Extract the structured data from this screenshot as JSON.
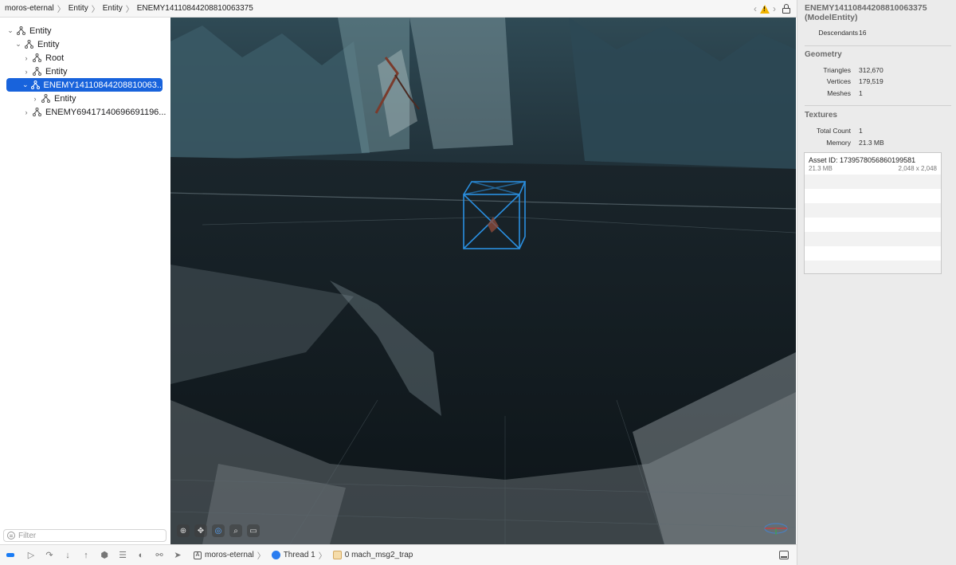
{
  "breadcrumb": [
    "moros-eternal",
    "Entity",
    "Entity",
    "ENEMY14110844208810063375"
  ],
  "outline": {
    "items": [
      {
        "label": "Entity",
        "expanded": true,
        "selected": false
      },
      {
        "label": "Entity",
        "expanded": true,
        "selected": false
      },
      {
        "label": "Root",
        "expanded": false,
        "selected": false
      },
      {
        "label": "Entity",
        "expanded": false,
        "selected": false
      },
      {
        "label": "ENEMY14110844208810063...",
        "expanded": true,
        "selected": true
      },
      {
        "label": "Entity",
        "expanded": false,
        "selected": false
      },
      {
        "label": "ENEMY69417140696691196...",
        "expanded": false,
        "selected": false
      }
    ],
    "filter_placeholder": "Filter"
  },
  "viewport": {
    "toolbar_icons": [
      "move-icon",
      "pan-icon",
      "orbit-icon",
      "zoom-icon",
      "camera-icon"
    ],
    "selection_color": "#2a8fe0"
  },
  "debugbar": {
    "app": "moros-eternal",
    "thread": "Thread 1",
    "frame": "0 mach_msg2_trap"
  },
  "inspector": {
    "title": "ENEMY14110844208810063375 (ModelEntity)",
    "descendants_label": "Descendants",
    "descendants_value": "16",
    "geometry": {
      "heading": "Geometry",
      "triangles_label": "Triangles",
      "triangles_value": "312,670",
      "vertices_label": "Vertices",
      "vertices_value": "179,519",
      "meshes_label": "Meshes",
      "meshes_value": "1"
    },
    "textures": {
      "heading": "Textures",
      "count_label": "Total Count",
      "count_value": "1",
      "memory_label": "Memory",
      "memory_value": "21.3 MB"
    },
    "asset": {
      "id": "Asset ID: 1739578056860199581",
      "size": "21.3 MB",
      "dims": "2,048 x 2,048"
    }
  }
}
